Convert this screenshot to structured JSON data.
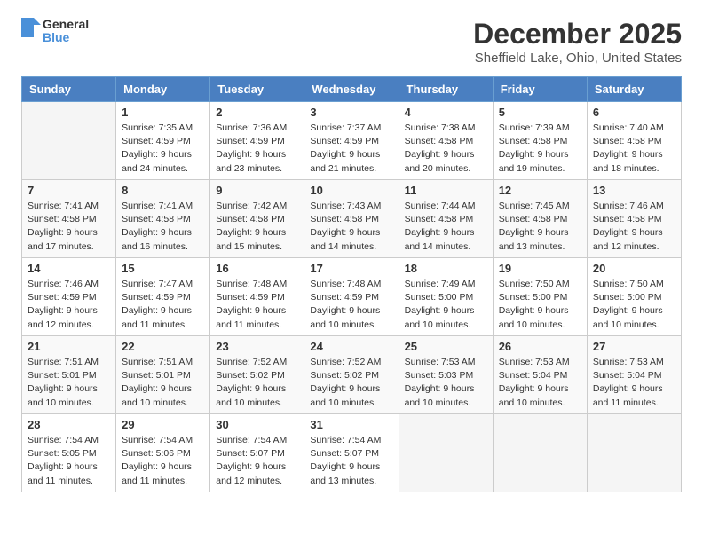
{
  "header": {
    "logo_line1": "General",
    "logo_line2": "Blue",
    "month_title": "December 2025",
    "location": "Sheffield Lake, Ohio, United States"
  },
  "days_of_week": [
    "Sunday",
    "Monday",
    "Tuesday",
    "Wednesday",
    "Thursday",
    "Friday",
    "Saturday"
  ],
  "weeks": [
    [
      {
        "day": "",
        "sunrise": "",
        "sunset": "",
        "daylight": ""
      },
      {
        "day": "1",
        "sunrise": "Sunrise: 7:35 AM",
        "sunset": "Sunset: 4:59 PM",
        "daylight": "Daylight: 9 hours and 24 minutes."
      },
      {
        "day": "2",
        "sunrise": "Sunrise: 7:36 AM",
        "sunset": "Sunset: 4:59 PM",
        "daylight": "Daylight: 9 hours and 23 minutes."
      },
      {
        "day": "3",
        "sunrise": "Sunrise: 7:37 AM",
        "sunset": "Sunset: 4:59 PM",
        "daylight": "Daylight: 9 hours and 21 minutes."
      },
      {
        "day": "4",
        "sunrise": "Sunrise: 7:38 AM",
        "sunset": "Sunset: 4:58 PM",
        "daylight": "Daylight: 9 hours and 20 minutes."
      },
      {
        "day": "5",
        "sunrise": "Sunrise: 7:39 AM",
        "sunset": "Sunset: 4:58 PM",
        "daylight": "Daylight: 9 hours and 19 minutes."
      },
      {
        "day": "6",
        "sunrise": "Sunrise: 7:40 AM",
        "sunset": "Sunset: 4:58 PM",
        "daylight": "Daylight: 9 hours and 18 minutes."
      }
    ],
    [
      {
        "day": "7",
        "sunrise": "Sunrise: 7:41 AM",
        "sunset": "Sunset: 4:58 PM",
        "daylight": "Daylight: 9 hours and 17 minutes."
      },
      {
        "day": "8",
        "sunrise": "Sunrise: 7:41 AM",
        "sunset": "Sunset: 4:58 PM",
        "daylight": "Daylight: 9 hours and 16 minutes."
      },
      {
        "day": "9",
        "sunrise": "Sunrise: 7:42 AM",
        "sunset": "Sunset: 4:58 PM",
        "daylight": "Daylight: 9 hours and 15 minutes."
      },
      {
        "day": "10",
        "sunrise": "Sunrise: 7:43 AM",
        "sunset": "Sunset: 4:58 PM",
        "daylight": "Daylight: 9 hours and 14 minutes."
      },
      {
        "day": "11",
        "sunrise": "Sunrise: 7:44 AM",
        "sunset": "Sunset: 4:58 PM",
        "daylight": "Daylight: 9 hours and 14 minutes."
      },
      {
        "day": "12",
        "sunrise": "Sunrise: 7:45 AM",
        "sunset": "Sunset: 4:58 PM",
        "daylight": "Daylight: 9 hours and 13 minutes."
      },
      {
        "day": "13",
        "sunrise": "Sunrise: 7:46 AM",
        "sunset": "Sunset: 4:58 PM",
        "daylight": "Daylight: 9 hours and 12 minutes."
      }
    ],
    [
      {
        "day": "14",
        "sunrise": "Sunrise: 7:46 AM",
        "sunset": "Sunset: 4:59 PM",
        "daylight": "Daylight: 9 hours and 12 minutes."
      },
      {
        "day": "15",
        "sunrise": "Sunrise: 7:47 AM",
        "sunset": "Sunset: 4:59 PM",
        "daylight": "Daylight: 9 hours and 11 minutes."
      },
      {
        "day": "16",
        "sunrise": "Sunrise: 7:48 AM",
        "sunset": "Sunset: 4:59 PM",
        "daylight": "Daylight: 9 hours and 11 minutes."
      },
      {
        "day": "17",
        "sunrise": "Sunrise: 7:48 AM",
        "sunset": "Sunset: 4:59 PM",
        "daylight": "Daylight: 9 hours and 10 minutes."
      },
      {
        "day": "18",
        "sunrise": "Sunrise: 7:49 AM",
        "sunset": "Sunset: 5:00 PM",
        "daylight": "Daylight: 9 hours and 10 minutes."
      },
      {
        "day": "19",
        "sunrise": "Sunrise: 7:50 AM",
        "sunset": "Sunset: 5:00 PM",
        "daylight": "Daylight: 9 hours and 10 minutes."
      },
      {
        "day": "20",
        "sunrise": "Sunrise: 7:50 AM",
        "sunset": "Sunset: 5:00 PM",
        "daylight": "Daylight: 9 hours and 10 minutes."
      }
    ],
    [
      {
        "day": "21",
        "sunrise": "Sunrise: 7:51 AM",
        "sunset": "Sunset: 5:01 PM",
        "daylight": "Daylight: 9 hours and 10 minutes."
      },
      {
        "day": "22",
        "sunrise": "Sunrise: 7:51 AM",
        "sunset": "Sunset: 5:01 PM",
        "daylight": "Daylight: 9 hours and 10 minutes."
      },
      {
        "day": "23",
        "sunrise": "Sunrise: 7:52 AM",
        "sunset": "Sunset: 5:02 PM",
        "daylight": "Daylight: 9 hours and 10 minutes."
      },
      {
        "day": "24",
        "sunrise": "Sunrise: 7:52 AM",
        "sunset": "Sunset: 5:02 PM",
        "daylight": "Daylight: 9 hours and 10 minutes."
      },
      {
        "day": "25",
        "sunrise": "Sunrise: 7:53 AM",
        "sunset": "Sunset: 5:03 PM",
        "daylight": "Daylight: 9 hours and 10 minutes."
      },
      {
        "day": "26",
        "sunrise": "Sunrise: 7:53 AM",
        "sunset": "Sunset: 5:04 PM",
        "daylight": "Daylight: 9 hours and 10 minutes."
      },
      {
        "day": "27",
        "sunrise": "Sunrise: 7:53 AM",
        "sunset": "Sunset: 5:04 PM",
        "daylight": "Daylight: 9 hours and 11 minutes."
      }
    ],
    [
      {
        "day": "28",
        "sunrise": "Sunrise: 7:54 AM",
        "sunset": "Sunset: 5:05 PM",
        "daylight": "Daylight: 9 hours and 11 minutes."
      },
      {
        "day": "29",
        "sunrise": "Sunrise: 7:54 AM",
        "sunset": "Sunset: 5:06 PM",
        "daylight": "Daylight: 9 hours and 11 minutes."
      },
      {
        "day": "30",
        "sunrise": "Sunrise: 7:54 AM",
        "sunset": "Sunset: 5:07 PM",
        "daylight": "Daylight: 9 hours and 12 minutes."
      },
      {
        "day": "31",
        "sunrise": "Sunrise: 7:54 AM",
        "sunset": "Sunset: 5:07 PM",
        "daylight": "Daylight: 9 hours and 13 minutes."
      },
      {
        "day": "",
        "sunrise": "",
        "sunset": "",
        "daylight": ""
      },
      {
        "day": "",
        "sunrise": "",
        "sunset": "",
        "daylight": ""
      },
      {
        "day": "",
        "sunrise": "",
        "sunset": "",
        "daylight": ""
      }
    ]
  ]
}
